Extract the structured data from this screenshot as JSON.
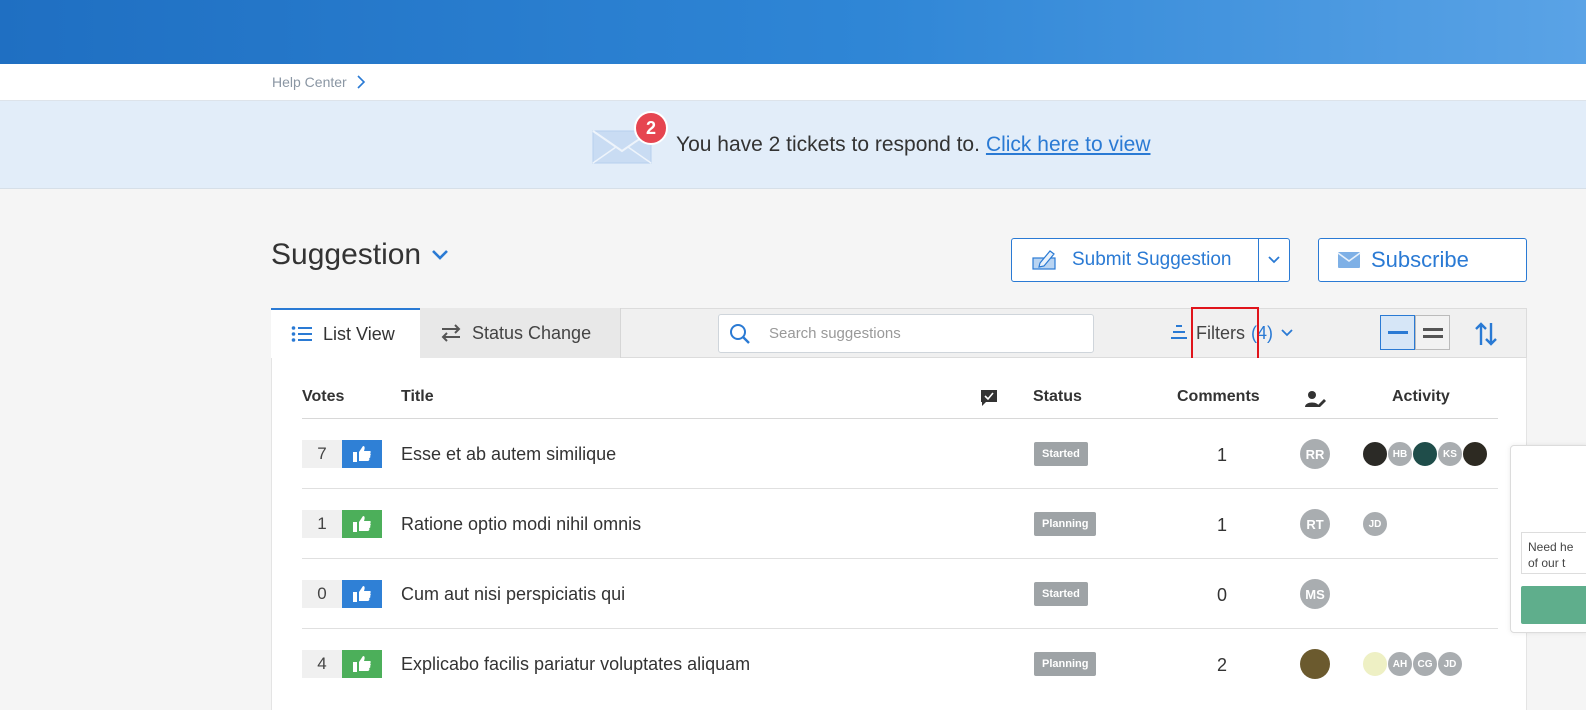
{
  "breadcrumb": {
    "home": "Help Center"
  },
  "notice": {
    "badge_count": "2",
    "text": "You have 2 tickets to respond to.",
    "link": "Click here to view"
  },
  "page": {
    "title": "Suggestion"
  },
  "actions": {
    "submit": "Submit Suggestion",
    "subscribe": "Subscribe"
  },
  "toolbar": {
    "tab_list": "List View",
    "tab_status": "Status Change",
    "search_placeholder": "Search suggestions",
    "filters_label": "Filters",
    "filters_count": "(4)"
  },
  "table": {
    "headers": {
      "votes": "Votes",
      "title": "Title",
      "status": "Status",
      "comments": "Comments",
      "activity": "Activity"
    },
    "rows": [
      {
        "votes": "7",
        "vote_color": "#2f80d6",
        "title": "Esse et ab autem similique",
        "status": "Started",
        "comments": "1",
        "assignee": "RR",
        "activity": [
          {
            "initials": "",
            "color": "#2b2a26"
          },
          {
            "initials": "HB",
            "color": "#a9adb0"
          },
          {
            "initials": "",
            "color": "#1f4d4a"
          },
          {
            "initials": "KS",
            "color": "#a9adb0"
          },
          {
            "initials": "",
            "color": "#2d2a22"
          }
        ]
      },
      {
        "votes": "1",
        "vote_color": "#4caf5a",
        "title": "Ratione optio modi nihil omnis",
        "status": "Planning",
        "comments": "1",
        "assignee": "RT",
        "activity": [
          {
            "initials": "JD",
            "color": "#a9adb0"
          }
        ]
      },
      {
        "votes": "0",
        "vote_color": "#2f80d6",
        "title": "Cum aut nisi perspiciatis qui",
        "status": "Started",
        "comments": "0",
        "assignee": "MS",
        "activity": []
      },
      {
        "votes": "4",
        "vote_color": "#4caf5a",
        "title": "Explicabo facilis pariatur voluptates aliquam",
        "status": "Planning",
        "comments": "2",
        "assignee": "",
        "activity": [
          {
            "initials": "",
            "color": "#eef0c4"
          },
          {
            "initials": "AH",
            "color": "#a9adb0"
          },
          {
            "initials": "CG",
            "color": "#a9adb0"
          },
          {
            "initials": "JD",
            "color": "#a9adb0"
          }
        ]
      }
    ]
  },
  "side_widget": {
    "text": "Need he of our t"
  },
  "colors": {
    "accent": "#2a7ad4",
    "badge": "#e64550",
    "highlight": "#e0141b"
  }
}
